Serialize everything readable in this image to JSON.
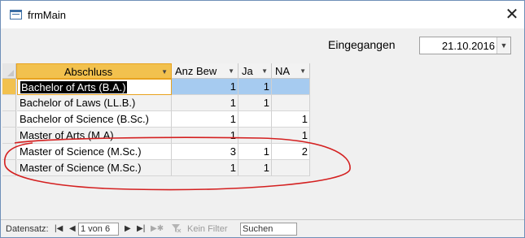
{
  "window": {
    "title": "frmMain"
  },
  "header": {
    "received_label": "Eingegangen",
    "received_date": "21.10.2016"
  },
  "table": {
    "columns": [
      "Abschluss",
      "Anz Bew",
      "Ja",
      "NA"
    ],
    "rows": [
      [
        "Bachelor of Arts (B.A.)",
        "1",
        "1",
        ""
      ],
      [
        "Bachelor of Laws (LL.B.)",
        "1",
        "1",
        ""
      ],
      [
        "Bachelor of Science (B.Sc.)",
        "1",
        "",
        "1"
      ],
      [
        "Master of Arts (M.A)",
        "1",
        "",
        "1"
      ],
      [
        "Master of Science (M.Sc.)",
        "3",
        "1",
        "2"
      ],
      [
        "Master of Science (M.Sc.)",
        "1",
        "1",
        ""
      ]
    ]
  },
  "statusbar": {
    "record_label": "Datensatz:",
    "record_position": "1 von 6",
    "filter_label": "Kein Filter",
    "search_placeholder": "Suchen"
  },
  "colors": {
    "selected_header": "#f2c14e",
    "selected_cells": "#a6cbf0",
    "annotation": "#d42020"
  }
}
